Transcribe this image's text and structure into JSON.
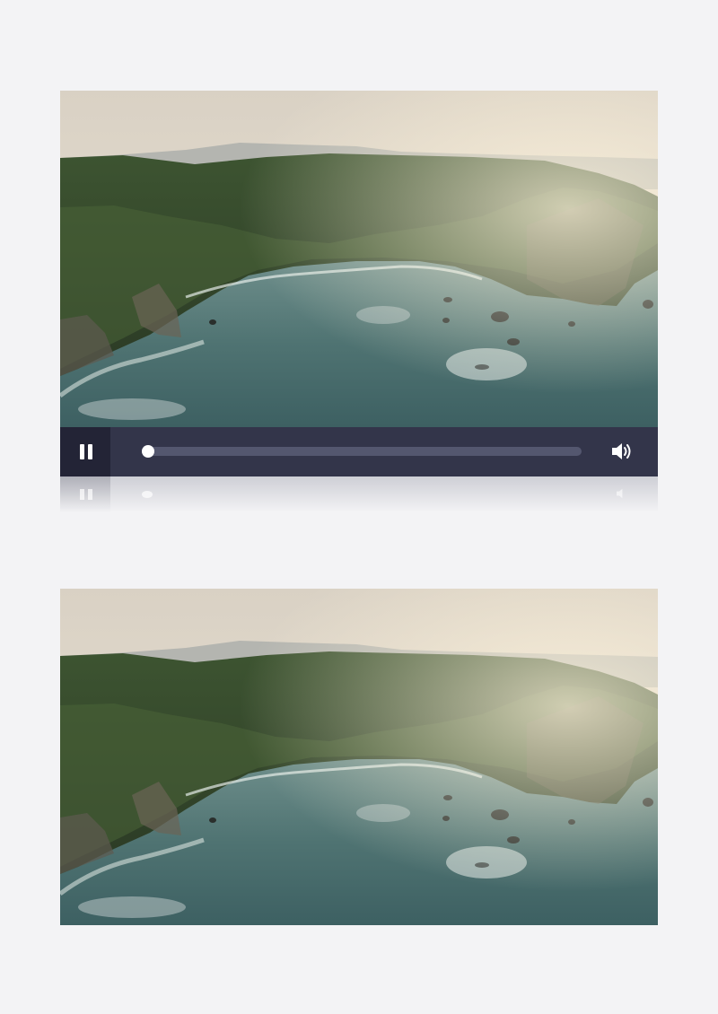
{
  "player": {
    "state": "playing",
    "progress": 0.0,
    "controls": {
      "pause_icon": "pause-icon",
      "volume_icon": "volume-icon"
    }
  },
  "colors": {
    "control_bar": "#33354a",
    "play_button_bg": "#232436",
    "track": "#54576f",
    "knob": "#ffffff",
    "page_background": "#f3f3f5"
  },
  "frames": [
    {
      "scene": "aerial-coastline-cove"
    },
    {
      "scene": "aerial-coastline-cove"
    }
  ]
}
